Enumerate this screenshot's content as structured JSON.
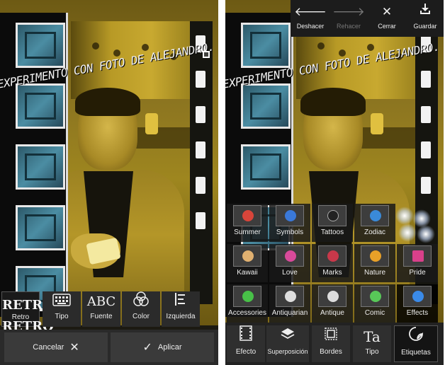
{
  "overlay_text": "EXPERIMENTO CON FOTO DE ALEJANDRO. ANDROIDPIT",
  "left": {
    "tools": [
      {
        "label": "Retro",
        "logo": "RETRO\nRETRO",
        "icon": "retro-logo-icon"
      },
      {
        "label": "Tipo",
        "icon": "keyboard-icon"
      },
      {
        "label": "Fuente",
        "glyph": "ABC",
        "icon": "font-abc-icon"
      },
      {
        "label": "Color",
        "icon": "color-circles-icon"
      },
      {
        "label": "Izquierda",
        "icon": "align-left-icon"
      }
    ],
    "cancel_label": "Cancelar",
    "apply_label": "Aplicar"
  },
  "right": {
    "top_actions": [
      {
        "label": "Deshacer",
        "icon": "arrow-left-icon",
        "enabled": true
      },
      {
        "label": "Rehacer",
        "icon": "arrow-right-icon",
        "enabled": false
      },
      {
        "label": "Cerrar",
        "icon": "close-icon",
        "enabled": true
      },
      {
        "label": "Guardar",
        "icon": "download-icon",
        "enabled": true
      }
    ],
    "stickers": [
      {
        "label": "Summer",
        "color": "#d8453a"
      },
      {
        "label": "Symbols",
        "color": "#3a78d8"
      },
      {
        "label": "Tattoos",
        "color": "#222222"
      },
      {
        "label": "Zodiac",
        "color": "#3a8ad8"
      },
      {
        "label": "",
        "color": ""
      },
      {
        "label": "Kawaii",
        "color": "#e0b070"
      },
      {
        "label": "Love",
        "color": "#d84a9a"
      },
      {
        "label": "Marks",
        "color": "#c8384a"
      },
      {
        "label": "Nature",
        "color": "#e8a028"
      },
      {
        "label": "Pride",
        "color": "#d8408a"
      },
      {
        "label": "Accessories",
        "color": "#48c048"
      },
      {
        "label": "Antiquarian",
        "color": "#dddddd"
      },
      {
        "label": "Antique",
        "color": "#dddddd"
      },
      {
        "label": "Comic",
        "color": "#58c858"
      },
      {
        "label": "Effects",
        "color": "#3a8ae8"
      }
    ],
    "bottom_tabs": [
      {
        "label": "Efecto",
        "icon": "film-icon"
      },
      {
        "label": "Superposición",
        "icon": "layers-icon"
      },
      {
        "label": "Bordes",
        "icon": "frame-icon"
      },
      {
        "label": "Tipo",
        "glyph": "Ta",
        "icon": "text-icon"
      },
      {
        "label": "Etiquetas",
        "icon": "sticker-icon"
      }
    ]
  }
}
